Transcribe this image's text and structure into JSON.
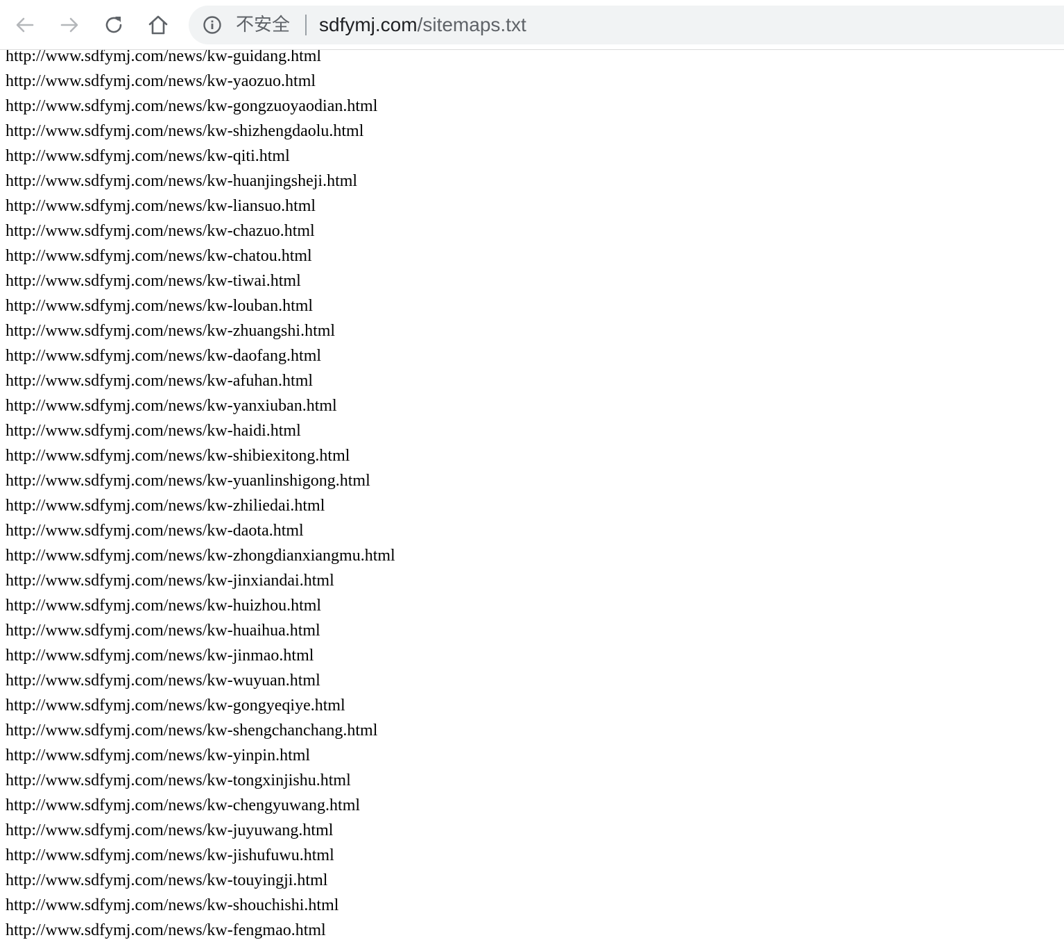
{
  "browser": {
    "back_icon": "arrow-left-icon",
    "forward_icon": "arrow-right-icon",
    "reload_icon": "reload-icon",
    "home_icon": "home-icon",
    "security_icon": "info-circle-icon",
    "security_label": "不安全",
    "url_host": "sdfymj.com",
    "url_path": "/sitemaps.txt"
  },
  "colors": {
    "toolbar_bg": "#ffffff",
    "omnibox_bg": "#f1f3f4",
    "icon_gray": "#5f6368",
    "icon_disabled": "#b4b7ba",
    "text": "#000000"
  },
  "sitemap": {
    "lines": [
      "http://www.sdfymj.com/news/kw-guidang.html",
      "http://www.sdfymj.com/news/kw-yaozuo.html",
      "http://www.sdfymj.com/news/kw-gongzuoyaodian.html",
      "http://www.sdfymj.com/news/kw-shizhengdaolu.html",
      "http://www.sdfymj.com/news/kw-qiti.html",
      "http://www.sdfymj.com/news/kw-huanjingsheji.html",
      "http://www.sdfymj.com/news/kw-liansuo.html",
      "http://www.sdfymj.com/news/kw-chazuo.html",
      "http://www.sdfymj.com/news/kw-chatou.html",
      "http://www.sdfymj.com/news/kw-tiwai.html",
      "http://www.sdfymj.com/news/kw-louban.html",
      "http://www.sdfymj.com/news/kw-zhuangshi.html",
      "http://www.sdfymj.com/news/kw-daofang.html",
      "http://www.sdfymj.com/news/kw-afuhan.html",
      "http://www.sdfymj.com/news/kw-yanxiuban.html",
      "http://www.sdfymj.com/news/kw-haidi.html",
      "http://www.sdfymj.com/news/kw-shibiexitong.html",
      "http://www.sdfymj.com/news/kw-yuanlinshigong.html",
      "http://www.sdfymj.com/news/kw-zhiliedai.html",
      "http://www.sdfymj.com/news/kw-daota.html",
      "http://www.sdfymj.com/news/kw-zhongdianxiangmu.html",
      "http://www.sdfymj.com/news/kw-jinxiandai.html",
      "http://www.sdfymj.com/news/kw-huizhou.html",
      "http://www.sdfymj.com/news/kw-huaihua.html",
      "http://www.sdfymj.com/news/kw-jinmao.html",
      "http://www.sdfymj.com/news/kw-wuyuan.html",
      "http://www.sdfymj.com/news/kw-gongyeqiye.html",
      "http://www.sdfymj.com/news/kw-shengchanchang.html",
      "http://www.sdfymj.com/news/kw-yinpin.html",
      "http://www.sdfymj.com/news/kw-tongxinjishu.html",
      "http://www.sdfymj.com/news/kw-chengyuwang.html",
      "http://www.sdfymj.com/news/kw-juyuwang.html",
      "http://www.sdfymj.com/news/kw-jishufuwu.html",
      "http://www.sdfymj.com/news/kw-touyingji.html",
      "http://www.sdfymj.com/news/kw-shouchishi.html",
      "http://www.sdfymj.com/news/kw-fengmao.html"
    ]
  }
}
